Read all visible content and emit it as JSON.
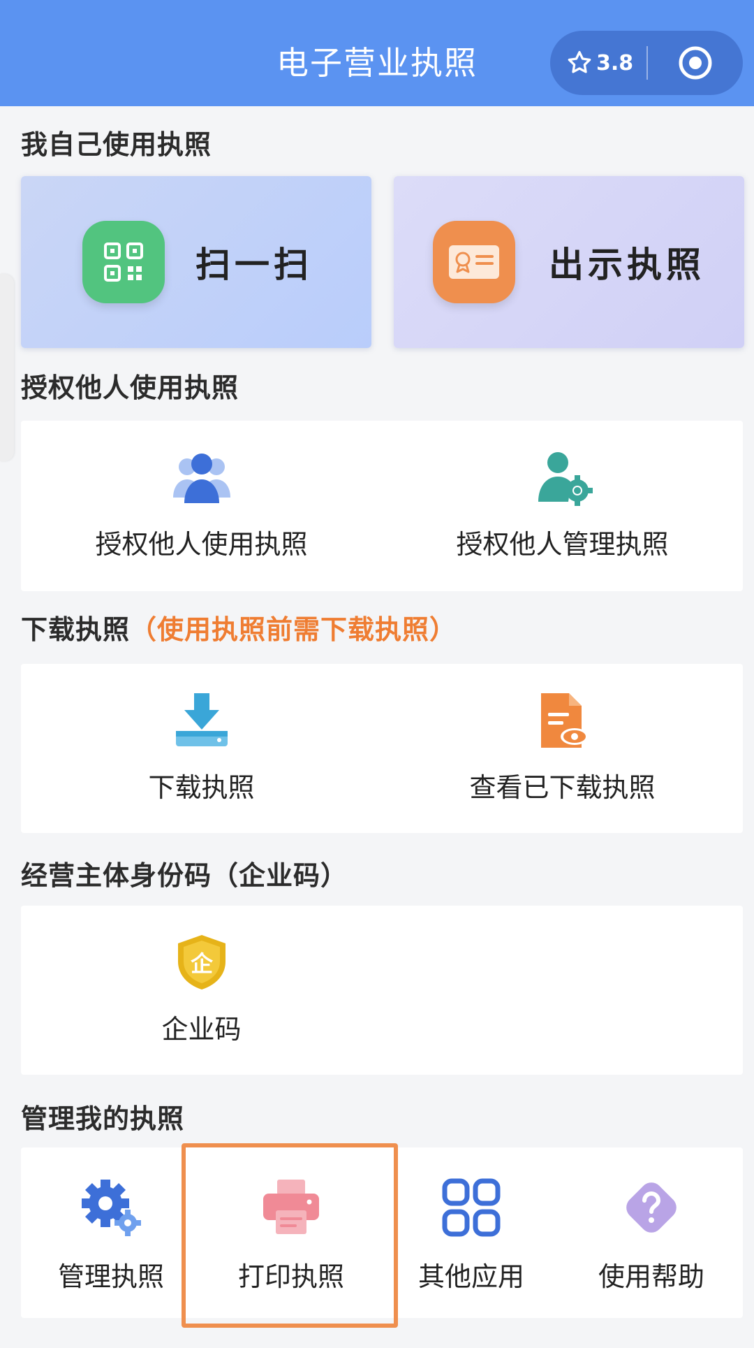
{
  "header": {
    "title": "电子营业执照",
    "rating": "3.8"
  },
  "sections": {
    "self_use": "我自己使用执照",
    "authorize": "授权他人使用执照",
    "download": "下载执照",
    "download_note": "（使用执照前需下载执照）",
    "identity": "经营主体身份码（企业码）",
    "manage": "管理我的执照"
  },
  "self_use": {
    "scan_label": "扫一扫",
    "show_label": "出示执照"
  },
  "authorize": {
    "use_label": "授权他人使用执照",
    "manage_label": "授权他人管理执照"
  },
  "download": {
    "download_label": "下载执照",
    "view_label": "查看已下载执照"
  },
  "identity": {
    "code_label": "企业码",
    "badge_char": "企"
  },
  "manage": {
    "items": [
      {
        "label": "管理执照"
      },
      {
        "label": "打印执照"
      },
      {
        "label": "其他应用"
      },
      {
        "label": "使用帮助"
      }
    ]
  },
  "colors": {
    "header": "#5b93f1",
    "accent_orange": "#ef7d32",
    "scan_green": "#52c47f",
    "license_orange": "#ef8f4e",
    "icon_blue": "#3d6fd8",
    "download_teal": "#3aa6d8",
    "shield_gold": "#e6b319",
    "help_purple": "#b9a4e6",
    "print_pink": "#f08a96"
  }
}
